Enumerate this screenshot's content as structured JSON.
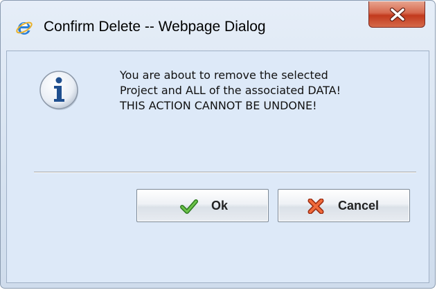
{
  "window": {
    "title": "Confirm Delete -- Webpage Dialog",
    "icons": {
      "app": "internet-explorer-icon",
      "close": "close-icon"
    }
  },
  "dialog": {
    "icon": "info-icon",
    "message_lines": [
      "You are about to remove the selected",
      "Project and ALL of the associated DATA!",
      "THIS ACTION CANNOT BE UNDONE!"
    ]
  },
  "buttons": {
    "ok": {
      "label": "Ok",
      "icon": "checkmark-icon"
    },
    "cancel": {
      "label": "Cancel",
      "icon": "x-icon"
    }
  },
  "colors": {
    "close_button": "#c94a30",
    "checkmark": "#3e9b2e",
    "cancel_x": "#d64520",
    "info_letter": "#1f4f8f"
  }
}
